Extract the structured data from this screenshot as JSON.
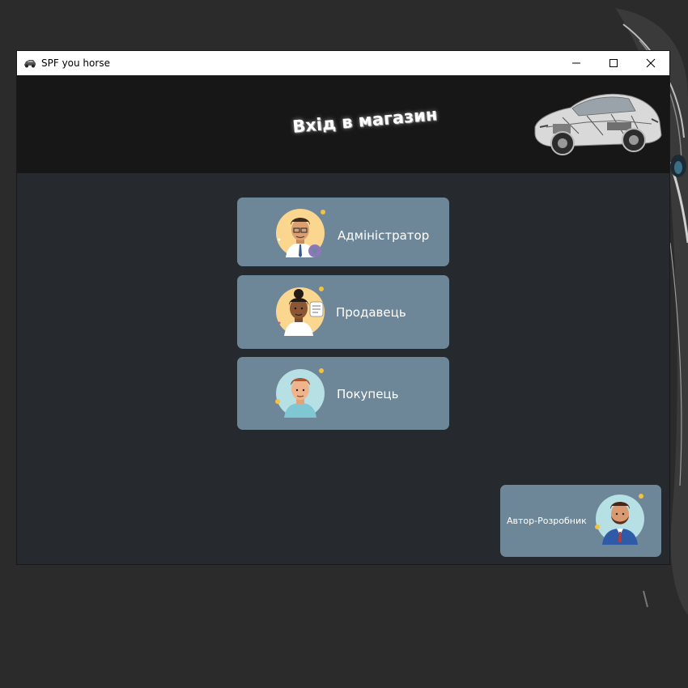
{
  "window": {
    "title": "SPF you horse",
    "controls": [
      "minimize-icon",
      "maximize-icon",
      "close-icon"
    ]
  },
  "header": {
    "title": "Вхід в магазин",
    "image": "car-xray-image"
  },
  "roles": [
    {
      "label": "Адміністратор",
      "icon": "administrator-avatar-icon"
    },
    {
      "label": "Продавець",
      "icon": "seller-avatar-icon"
    },
    {
      "label": "Покупець",
      "icon": "buyer-avatar-icon"
    }
  ],
  "author": {
    "label": "Автор-Розробник",
    "icon": "developer-avatar-icon"
  },
  "colors": {
    "button_bg": "#6d8799",
    "header_bg": "#171717",
    "window_bg": "#262a2e",
    "titlebar_bg": "#ffffff"
  }
}
